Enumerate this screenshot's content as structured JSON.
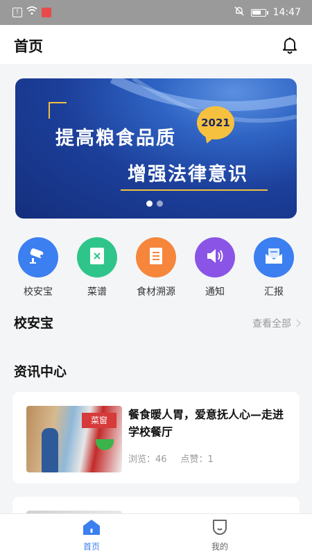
{
  "status_bar": {
    "time": "14:47",
    "battery_level": 0.7
  },
  "header": {
    "title": "首页"
  },
  "banner": {
    "line1": "提高粮食品质",
    "line2": "增强法律意识",
    "badge": "2021",
    "slide_count": 2,
    "active_slide": 1
  },
  "quick_links": [
    {
      "label": "校安宝",
      "icon": "camera-icon",
      "color": "#3b7ff0"
    },
    {
      "label": "菜谱",
      "icon": "menu-book-icon",
      "color": "#2fc58a"
    },
    {
      "label": "食材溯源",
      "icon": "receipt-icon",
      "color": "#f5863c"
    },
    {
      "label": "通知",
      "icon": "speaker-icon",
      "color": "#8a55e6"
    },
    {
      "label": "汇报",
      "icon": "mail-icon",
      "color": "#3b7ff0"
    }
  ],
  "section_safety": {
    "title": "校安宝",
    "view_all": "查看全部"
  },
  "section_news": {
    "title": "资讯中心"
  },
  "news": [
    {
      "title": "餐食暖人胃，爱意抚人心—走进学校餐厅",
      "views_label": "浏览：46",
      "likes_label": "点赞：1",
      "thumb_sign": "菜窗"
    }
  ],
  "tabbar": {
    "items": [
      {
        "label": "首页",
        "active": true,
        "color": "#3b7ff0"
      },
      {
        "label": "我的",
        "active": false,
        "color": "#666666"
      }
    ]
  }
}
